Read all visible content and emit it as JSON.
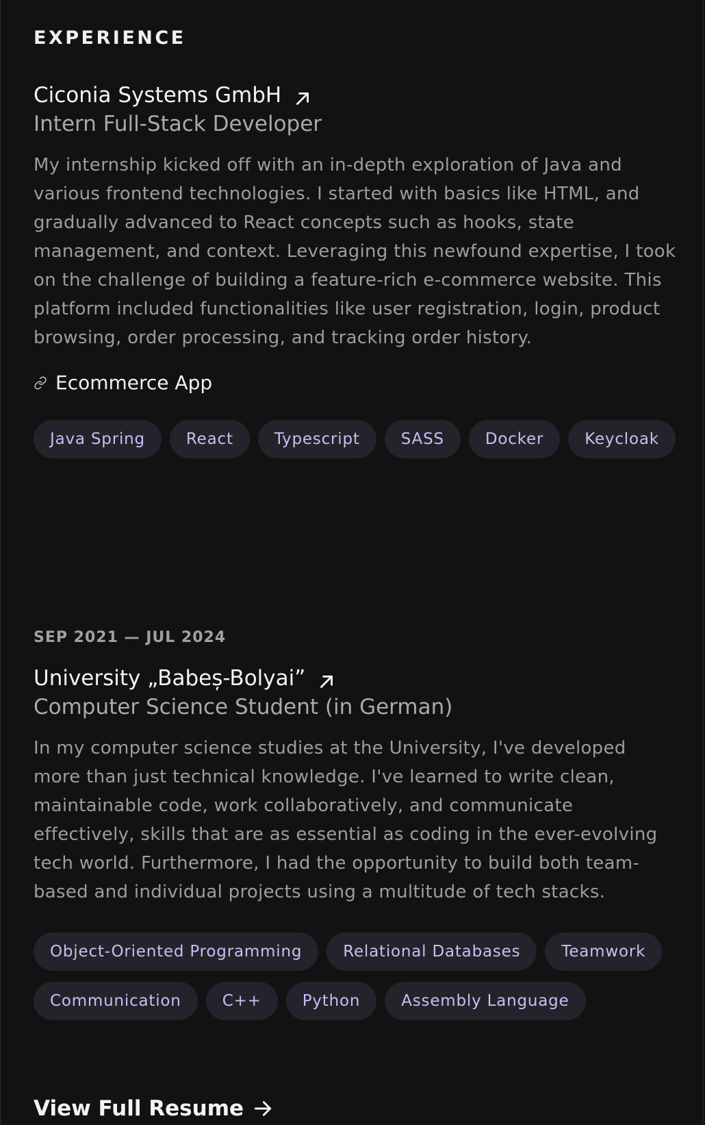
{
  "section": {
    "title": "EXPERIENCE"
  },
  "experience": [
    {
      "date": "",
      "organization": "Ciconia Systems GmbH",
      "role": "Intern Full-Stack Developer",
      "description": "My internship kicked off with an in-depth exploration of Java and various frontend technologies. I started with basics like HTML, and gradually advanced to React concepts such as hooks, state management, and context. Leveraging this newfound expertise, I took on the challenge of building a feature-rich e-commerce website. This platform included functionalities like user registration, login, product browsing, order processing, and tracking order history.",
      "link_label": "Ecommerce App",
      "tags": [
        "Java Spring",
        "React",
        "Typescript",
        "SASS",
        "Docker",
        "Keycloak"
      ]
    },
    {
      "date": "SEP 2021 — JUL 2024",
      "organization": "University „Babeș-Bolyai”",
      "role": "Computer Science Student (in German)",
      "description": "In my computer science studies at the University, I've developed more than just technical knowledge. I've learned to write clean, maintainable code, work collaboratively, and communicate effectively, skills that are as essential as coding in the ever-evolving tech world. Furthermore, I had the opportunity to build both team-based and individual projects using a multitude of tech stacks.",
      "tags": [
        "Object-Oriented Programming",
        "Relational Databases",
        "Teamwork",
        "Communication",
        "C++",
        "Python",
        "Assembly Language"
      ]
    }
  ],
  "footer": {
    "resume_label": "View Full Resume"
  },
  "colors": {
    "background": "#121213",
    "tag_bg": "#24232b",
    "tag_text": "#c7bff2",
    "muted_text": "#9c9ca2"
  },
  "icons": {
    "external_link": "arrow-up-right-icon",
    "link": "link-chain-icon",
    "resume_arrow": "arrow-right-icon"
  }
}
